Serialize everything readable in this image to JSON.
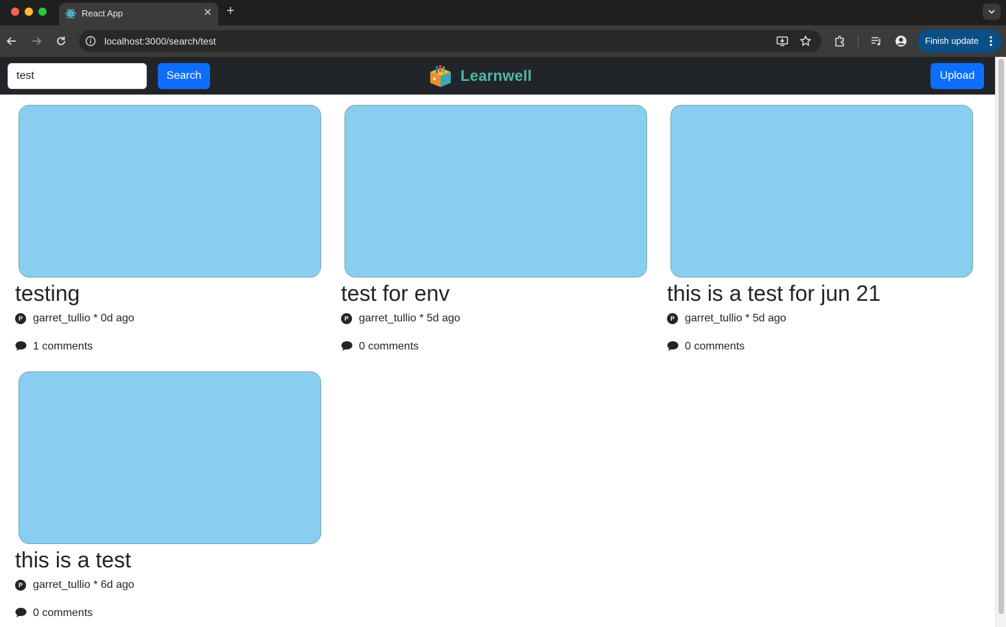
{
  "browser": {
    "tab_title": "React App",
    "tab_close": "✕",
    "new_tab": "+",
    "url": "localhost:3000/search/test",
    "finish_update_label": "Finish update"
  },
  "nav": {
    "search_value": "test",
    "search_button": "Search",
    "brand_name": "Learnwell",
    "upload_button": "Upload"
  },
  "colors": {
    "nav_bg": "#212529",
    "primary": "#0d6efd",
    "thumbnail": "#89ceef",
    "brand": "#4fb8a8"
  },
  "posts": [
    {
      "title": "testing",
      "author": "garret_tullio",
      "separator": "*",
      "age": "0d ago",
      "comments": "1 comments",
      "avatar_letter": "P"
    },
    {
      "title": "test for env",
      "author": "garret_tullio",
      "separator": "*",
      "age": "5d ago",
      "comments": "0 comments",
      "avatar_letter": "P"
    },
    {
      "title": "this is a test for jun 21",
      "author": "garret_tullio",
      "separator": "*",
      "age": "5d ago",
      "comments": "0 comments",
      "avatar_letter": "P"
    },
    {
      "title": "this is a test",
      "author": "garret_tullio",
      "separator": "*",
      "age": "6d ago",
      "comments": "0 comments",
      "avatar_letter": "P"
    }
  ]
}
